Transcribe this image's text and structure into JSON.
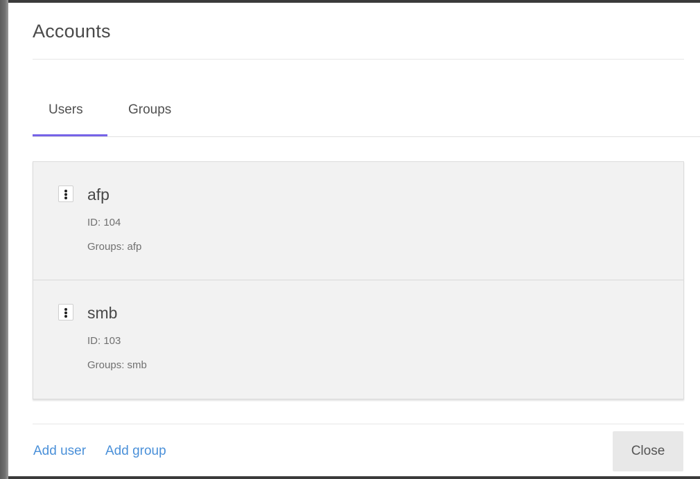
{
  "dialog": {
    "title": "Accounts"
  },
  "tabs": [
    {
      "label": "Users",
      "active": true
    },
    {
      "label": "Groups",
      "active": false
    }
  ],
  "users": [
    {
      "name": "afp",
      "id_text": "ID: 104",
      "groups_text": "Groups: afp",
      "menu_icon": "vertical-dots-icon"
    },
    {
      "name": "smb",
      "id_text": "ID: 103",
      "groups_text": "Groups: smb",
      "menu_icon": "vertical-dots-icon"
    }
  ],
  "footer": {
    "add_user_label": "Add user",
    "add_group_label": "Add group",
    "close_label": "Close"
  },
  "colors": {
    "accent": "#7563e8",
    "link": "#4a90d9",
    "list_background": "#f2f2f2"
  }
}
